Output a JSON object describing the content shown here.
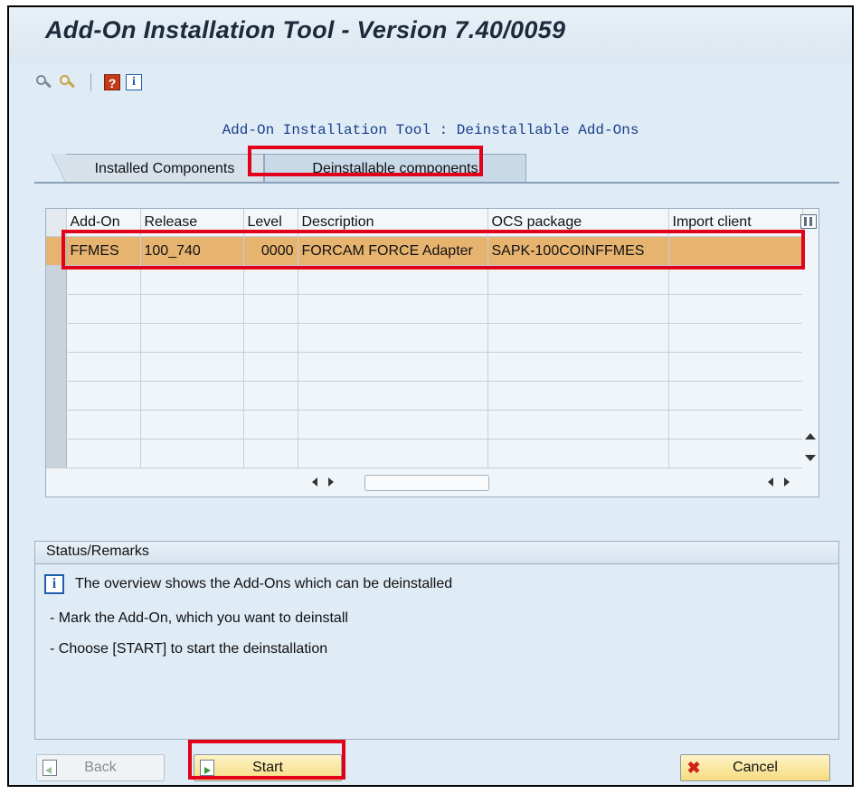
{
  "window": {
    "title": "Add-On Installation Tool - Version 7.40/0059"
  },
  "toolbar": {
    "icons": [
      "find-icon",
      "find-next-icon",
      "help-icon",
      "info-icon"
    ],
    "help_glyph": "?",
    "info_glyph": "i"
  },
  "screen": {
    "heading": "Add-On Installation Tool : Deinstallable Add-Ons"
  },
  "tabs": [
    {
      "label": "Installed Components",
      "active": false
    },
    {
      "label": "Deinstallable components",
      "active": true
    }
  ],
  "table": {
    "columns": [
      "Add-On",
      "Release",
      "Level",
      "Description",
      "OCS package",
      "Import client"
    ],
    "rows": [
      {
        "addon": "FFMES",
        "release": "100_740",
        "level": "0000",
        "description": "FORCAM FORCE Adapter",
        "ocs_package": "SAPK-100COINFFMES",
        "import_client": "",
        "selected": true
      }
    ],
    "empty_rows": 7
  },
  "status": {
    "header": "Status/Remarks",
    "lines": [
      "The overview shows the Add-Ons which can be deinstalled",
      "- Mark the Add-On, which you want to deinstall",
      "- Choose [START] to start the deinstallation"
    ]
  },
  "buttons": {
    "back": "Back",
    "start": "Start",
    "cancel": "Cancel"
  },
  "colors": {
    "highlight": "#e3001b",
    "selected_row": "#e7b470",
    "background": "#dfebf5"
  }
}
